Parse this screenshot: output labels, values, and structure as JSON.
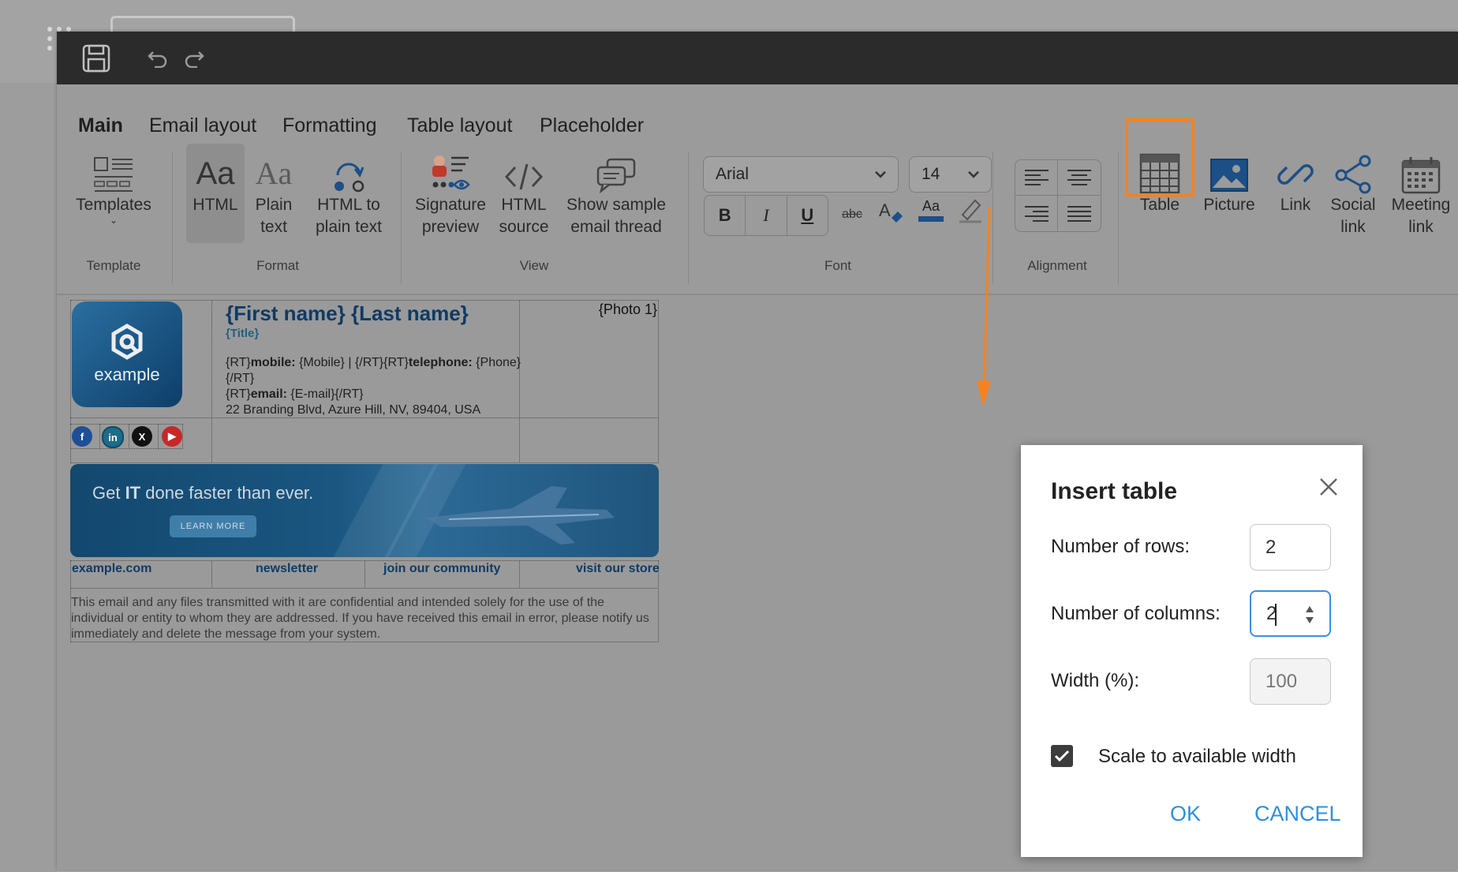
{
  "tabs": [
    "Main",
    "Email layout",
    "Formatting",
    "Table layout",
    "Placeholder"
  ],
  "ribbon": {
    "templates": "Templates",
    "html": "HTML",
    "plain_text": [
      "Plain",
      "text"
    ],
    "html_to_plain": [
      "HTML to",
      "plain text"
    ],
    "signature_preview": [
      "Signature",
      "preview"
    ],
    "html_source": [
      "HTML",
      "source"
    ],
    "show_sample": [
      "Show sample",
      "email thread"
    ],
    "font_name": "Arial",
    "font_size": "14",
    "bold": "B",
    "italic": "I",
    "underline": "U",
    "strike": "abc",
    "font_color": "Aa",
    "table": "Table",
    "picture": "Picture",
    "link": "Link",
    "social_link": [
      "Social",
      "link"
    ],
    "meeting_link": [
      "Meeting",
      "link"
    ]
  },
  "groups": {
    "template": "Template",
    "format": "Format",
    "view": "View",
    "font": "Font",
    "alignment": "Alignment"
  },
  "signature": {
    "logo_text": "example",
    "name": "{First name} {Last name}",
    "title": "{Title}",
    "photo": "{Photo 1}",
    "line1_a": "{RT}",
    "line1_b": "mobile:",
    "line1_c": " {Mobile}  |  {/RT}{RT}",
    "line1_d": "telephone:",
    "line1_e": " {Phone}",
    "line2": "{/RT}",
    "line3_a": "{RT}",
    "line3_b": "email:",
    "line3_c": " {E-mail}{/RT}",
    "address": "22 Branding Blvd, Azure Hill, NV, 89404, USA",
    "social_icons": [
      "facebook-icon",
      "linkedin-icon",
      "x-icon",
      "youtube-icon"
    ],
    "banner_headline_pre": "Get ",
    "banner_headline_bold": "IT",
    "banner_headline_post": " done faster than ever.",
    "banner_button": "LEARN MORE",
    "links": [
      "example.com",
      "newsletter",
      "join our community",
      "visit our store"
    ],
    "disclaimer": "This email and any files transmitted with it are confidential and intended solely for the use of the individual or entity to whom they are addressed. If you have received this email in error, please notify us immediately and delete the message from your system."
  },
  "dialog": {
    "title": "Insert table",
    "rows_label": "Number of rows:",
    "rows_value": "2",
    "cols_label": "Number of columns:",
    "cols_value": "2",
    "width_label": "Width (%):",
    "width_value": "100",
    "scale_label": "Scale to available width",
    "scale_checked": true,
    "ok": "OK",
    "cancel": "CANCEL"
  },
  "colors": {
    "accent_orange": "#f58220",
    "tab_underline": "#2f80d3",
    "link_blue": "#2f8fdc",
    "name_blue": "#0e3b66"
  }
}
